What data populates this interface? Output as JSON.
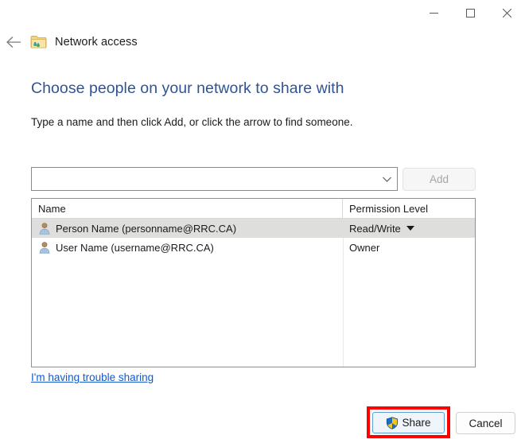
{
  "window": {
    "titlebar": {
      "minimize_label": "Minimize",
      "maximize_label": "Maximize",
      "close_label": "Close"
    },
    "nav": {
      "back_label": "Back",
      "icon": "shared-folder-icon",
      "title": "Network access"
    }
  },
  "main": {
    "heading": "Choose people on your network to share with",
    "subtext": "Type a name and then click Add, or click the arrow to find someone.",
    "name_combo": {
      "value": "",
      "placeholder": ""
    },
    "add_button": {
      "label": "Add",
      "disabled": true
    },
    "list": {
      "columns": [
        "Name",
        "Permission Level"
      ],
      "rows": [
        {
          "name": "Person Name (personname@RRC.CA)",
          "permission": "Read/Write",
          "has_dropdown": true,
          "selected": true
        },
        {
          "name": "User Name (username@RRC.CA)",
          "permission": "Owner",
          "has_dropdown": false,
          "selected": false
        }
      ]
    },
    "trouble_link": "I'm having trouble sharing"
  },
  "footer": {
    "share_label": "Share",
    "cancel_label": "Cancel"
  },
  "colors": {
    "heading_blue": "#2f5496",
    "link_blue": "#1558c8",
    "annotation_red": "#fe0000",
    "selection_grey": "#dededc",
    "share_border_blue": "#5a9fd4"
  }
}
